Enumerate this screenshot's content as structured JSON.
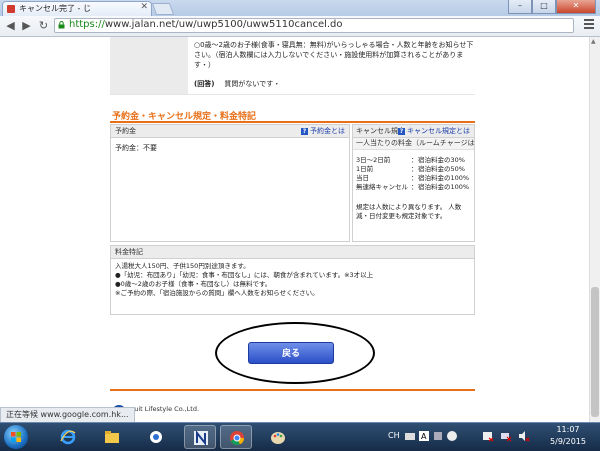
{
  "browser": {
    "tab_title": "キャンセル完了 - じ",
    "url_scheme": "https://",
    "url_rest": "www.jalan.net/uw/uwp5100/uww5110cancel.do",
    "window_buttons": [
      "–",
      "□",
      "✕"
    ],
    "status_text": "正在等候 www.google.com.hk..."
  },
  "qa": {
    "question": "○0歳～2歳のお子様(食事・寝具無：無料)がいらっしゃる場合・人数と年齢をお知らせ下さい。（宿泊人数欄には入力しないでください・施設使用料が加算されることがあります・）",
    "answer_label": "(回答)",
    "answer_text": "質問がないです・"
  },
  "section_title": "予約金・キャンセル規定・料金特記",
  "deposit": {
    "header": "予約金",
    "help_link": "予約金とは",
    "text": "予約金：不要"
  },
  "cancel_policy": {
    "header": "キャンセル規定",
    "help_link": "キャンセル規定とは",
    "subheader": "一人当たりの料金（ルームチャージはルームあたり）",
    "rows": [
      {
        "when": "3日～2日前",
        "colon": "：",
        "fee": "宿泊料金の30%"
      },
      {
        "when": "1日前",
        "colon": "：",
        "fee": "宿泊料金の50%"
      },
      {
        "when": "当日",
        "colon": "：",
        "fee": "宿泊料金の100%"
      },
      {
        "when": "無連絡キャンセル",
        "colon": "：",
        "fee": "宿泊料金の100%"
      }
    ],
    "note": "規定は人数により異なります。 人数減・日付変更も規定対象です。"
  },
  "fee_notes": {
    "header": "料金特記",
    "lines": [
      "入湯税大人150円、子供150円別途頂きます。",
      "●「幼児：布団あり」「幼児：食事・布団なし」には、朝食が含まれています。※3才以上",
      "●0歳～2歳のお子様（食事・布団なし）は無料です。",
      "※ご予約の際、「宿泊施設からの質問」欄へ人数をお知らせください。"
    ]
  },
  "back_button": "戻る",
  "footer": {
    "copyright": "cruit Lifestyle Co.,Ltd."
  },
  "taskbar": {
    "lang": "CH",
    "time": "11:07",
    "date": "5/9/2015"
  }
}
